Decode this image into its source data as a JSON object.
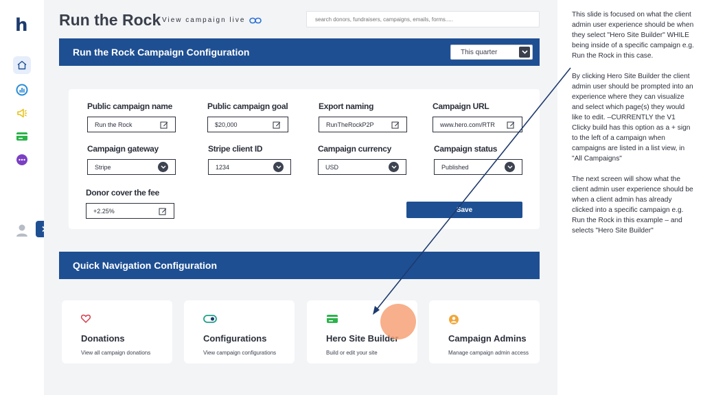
{
  "app": {
    "logo": "h",
    "page_title": "Run the Rock",
    "campaign_live_label": "View campaign live",
    "search_placeholder": "search donors, fundraisers, campaigns, emails, forms....."
  },
  "sidebar": {
    "items": [
      "home-icon",
      "analytics-icon",
      "megaphone-icon",
      "card-icon",
      "more-icon"
    ]
  },
  "config": {
    "title": "Run the Rock Campaign Configuration",
    "period": "This quarter",
    "fields": {
      "public_name": {
        "label": "Public campaign name",
        "value": "Run the Rock"
      },
      "goal": {
        "label": "Public campaign goal",
        "value": "$20,000"
      },
      "export_naming": {
        "label": "Export naming",
        "value": "RunTheRockP2P"
      },
      "url": {
        "label": "Campaign URL",
        "value": "www.hero.com/RTR"
      },
      "gateway": {
        "label": "Campaign gateway",
        "value": "Stripe"
      },
      "stripe_id": {
        "label": "Stripe client ID",
        "value": "1234"
      },
      "currency": {
        "label": "Campaign currency",
        "value": "USD"
      },
      "status": {
        "label": "Campaign status",
        "value": "Published"
      },
      "donor_fee": {
        "label": "Donor cover the fee",
        "value": "+2.25%"
      }
    },
    "save_label": "Save"
  },
  "quick_nav": {
    "title": "Quick Navigation Configuration",
    "cards": [
      {
        "title": "Donations",
        "desc": "View all campaign donations",
        "icon": "heart-icon"
      },
      {
        "title": "Configurations",
        "desc": "View campaign configurations",
        "icon": "toggle-icon"
      },
      {
        "title": "Hero Site Builder",
        "desc": "Build or edit your site",
        "icon": "card-icon"
      },
      {
        "title": "Campaign Admins",
        "desc": "Manage campaign admin access",
        "icon": "admin-icon"
      }
    ]
  },
  "notes": {
    "p1": "This slide is focused on what the client admin user experience should be when they select \"Hero Site Builder\" WHILE being inside of a specific campaign e.g. Run the Rock in this case.",
    "p2": "By clicking Hero Site Builder the client admin user should be prompted into an experience where they can visualize and select which page(s) they would like to edit. –CURRENTLY the V1 Clicky build has this option as a + sign to the left of a campaign when campaigns are listed in a list view, in \"All Campaigns\"",
    "p3": "The next screen will show what the client admin user experience should be when a client admin has already clicked into a specific campaign e.g. Run the Rock in this example – and selects \"Hero Site Builder\""
  },
  "colors": {
    "primary": "#1e4f93",
    "highlight": "#f59c6e",
    "background": "#f3f4f6"
  }
}
